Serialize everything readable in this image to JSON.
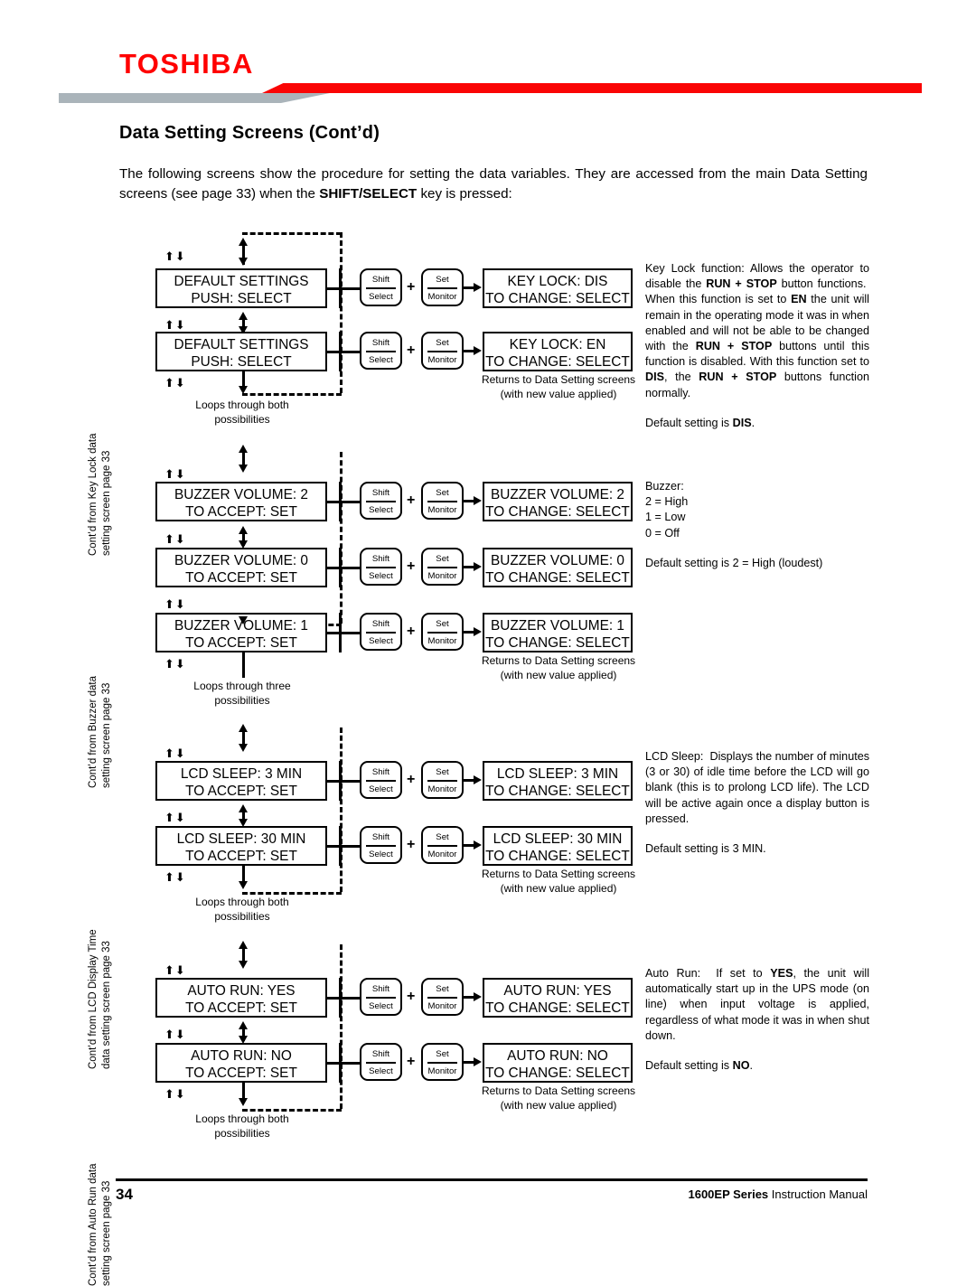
{
  "header": {
    "brand": "TOSHIBA",
    "title": "Data Setting Screens (Cont’d)",
    "intro_line1": "The following screens show the procedure for setting the data variables. They are accessed from the main",
    "intro_line2_a": "Data Setting screens (see page 33) when the ",
    "intro_line2_b": "SHIFT/SELECT",
    "intro_line2_c": " key is pressed:"
  },
  "keys": {
    "shift_top": "Shift",
    "shift_bottom": "Select",
    "set_top": "Set",
    "set_bottom": "Monitor",
    "plus": "+"
  },
  "glyphs": {
    "up_arrow": "⬆",
    "down_arrow": "⬇",
    "arrow_pair": "▲▼"
  },
  "captions": {
    "returns_line1": "Returns to Data Setting screens",
    "returns_line2": "(with new value applied)",
    "loops_both_line1": "Loops through both",
    "loops_both_line2": "possibilities",
    "loops_three_line1": "Loops through three",
    "loops_three_line2": "possibilities"
  },
  "sections": [
    {
      "id": "key-lock",
      "side_label_line1": "Cont’d from Key Lock data",
      "side_label_line2": "setting screen page 33",
      "loop_caption_line1": "Loops through both",
      "loop_caption_line2": "possibilities",
      "rows": [
        {
          "left_line1": "DEFAULT SETTINGS",
          "left_line2": "PUSH: SELECT",
          "right_line1": "KEY LOCK: DIS",
          "right_line2": "TO CHANGE: SELECT"
        },
        {
          "left_line1": "DEFAULT SETTINGS",
          "left_line2": "PUSH: SELECT",
          "right_line1": "KEY LOCK: EN",
          "right_line2": "TO CHANGE: SELECT"
        }
      ],
      "description": {
        "heading": "Key Lock function:",
        "paragraphs": [
          "Key Lock function: Allows the operator to disable the RUN + STOP button functions. When this function is set to EN the unit will remain in the operating mode it was in when enabled and will not be able to be changed with the RUN + STOP buttons until this function is disabled. With this function set to DIS, the RUN + STOP buttons function normally.",
          "Default setting is DIS."
        ]
      }
    },
    {
      "id": "buzzer",
      "side_label_line1": "Cont’d from Buzzer data",
      "side_label_line2": "setting screen page 33",
      "loop_caption_line1": "Loops through three",
      "loop_caption_line2": "possibilities",
      "rows": [
        {
          "left_line1": "BUZZER VOLUME: 2",
          "left_line2": "TO ACCEPT: SET",
          "right_line1": "BUZZER VOLUME: 2",
          "right_line2": "TO CHANGE: SELECT"
        },
        {
          "left_line1": "BUZZER VOLUME: 0",
          "left_line2": "TO ACCEPT: SET",
          "right_line1": "BUZZER VOLUME: 0",
          "right_line2": "TO CHANGE: SELECT"
        },
        {
          "left_line1": "BUZZER VOLUME: 1",
          "left_line2": "TO ACCEPT: SET",
          "right_line1": "BUZZER VOLUME: 1",
          "right_line2": "TO CHANGE: SELECT"
        }
      ],
      "description": {
        "heading": "Buzzer:",
        "legend": [
          "Buzzer:",
          "2 = High",
          "1 = Low",
          "0 = Off"
        ],
        "default": "Default setting is 2 = High (loudest)"
      }
    },
    {
      "id": "lcd-sleep",
      "side_label_line1": "Cont’d from LCD Display Time",
      "side_label_line2": "data setting screen page 33",
      "loop_caption_line1": "Loops through both",
      "loop_caption_line2": "possibilities",
      "rows": [
        {
          "left_line1": "LCD SLEEP: 3 MIN",
          "left_line2": "TO ACCEPT: SET",
          "right_line1": "LCD SLEEP: 3 MIN",
          "right_line2": "TO CHANGE: SELECT"
        },
        {
          "left_line1": "LCD SLEEP: 30 MIN",
          "left_line2": "TO ACCEPT: SET",
          "right_line1": "LCD SLEEP: 30 MIN",
          "right_line2": "TO CHANGE: SELECT"
        }
      ],
      "description": {
        "heading": "LCD Sleep:",
        "paragraphs": [
          "LCD Sleep: Displays the number of minutes (3 or 30) of idle time before the LCD will go blank (this is to prolong LCD life). The LCD will be active again once a display button is pressed.",
          "Default setting is 3 MIN."
        ]
      }
    },
    {
      "id": "auto-run",
      "side_label_line1": "Cont’d from Auto Run data",
      "side_label_line2": "setting screen page 33",
      "loop_caption_line1": "Loops through both",
      "loop_caption_line2": "possibilities",
      "rows": [
        {
          "left_line1": "AUTO RUN: YES",
          "left_line2": "TO ACCEPT: SET",
          "right_line1": "AUTO RUN: YES",
          "right_line2": "TO CHANGE: SELECT"
        },
        {
          "left_line1": "AUTO RUN: NO",
          "left_line2": "TO ACCEPT: SET",
          "right_line1": "AUTO RUN: NO",
          "right_line2": "TO CHANGE: SELECT"
        }
      ],
      "description": {
        "heading": "Auto Run:",
        "paragraphs": [
          "Auto Run: If set to YES, the unit will automatically start up in the UPS mode (on line) when input voltage is applied, regardless of what mode it was in when shut down.",
          "Default setting is NO."
        ]
      }
    }
  ],
  "footer": {
    "page_number": "34",
    "manual_bold": "1600EP Series",
    "manual_rest": " Instruction Manual"
  },
  "colors": {
    "brand_red": "#ff0000",
    "header_gray": "#aab4ba",
    "text": "#000000",
    "page_background": "#ffffff"
  }
}
